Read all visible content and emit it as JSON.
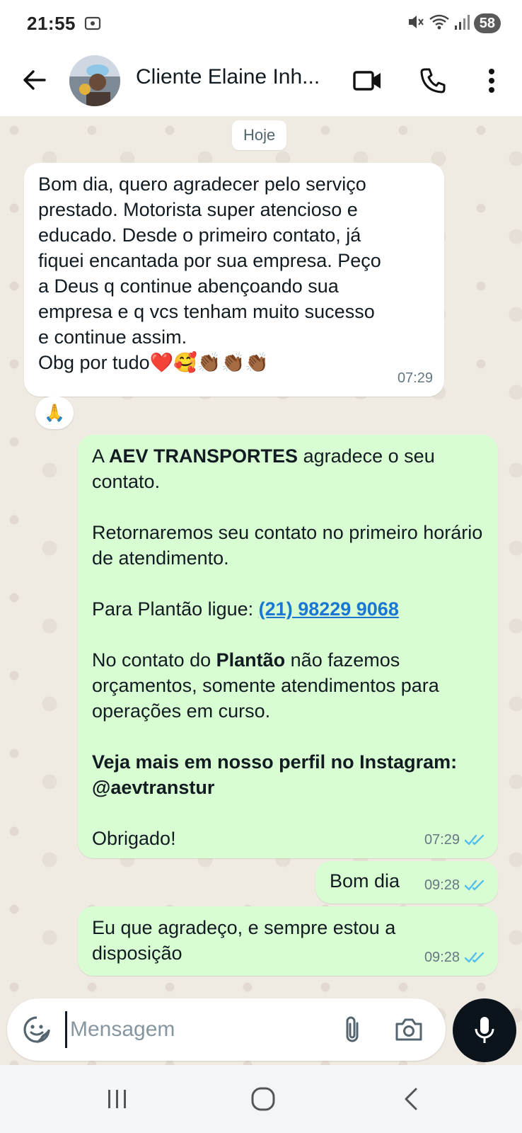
{
  "status_bar": {
    "time": "21:55",
    "battery": "58"
  },
  "header": {
    "contact_name": "Cliente Elaine Inh..."
  },
  "chat": {
    "date_chip": "Hoje",
    "messages": [
      {
        "direction": "incoming",
        "lines": [
          "Bom dia,  quero agradecer pelo serviço",
          "prestado. Motorista super atencioso e",
          "educado. Desde o primeiro contato, já",
          "fiquei encantada por sua empresa. Peço",
          "a Deus q continue abençoando sua",
          "empresa e q vcs tenham muito sucesso",
          "e continue assim.",
          "Obg por tudo❤️🥰👏🏾👏🏾👏🏾"
        ],
        "time": "07:29",
        "reaction": "🙏"
      },
      {
        "direction": "outgoing",
        "p1_prefix": "A ",
        "p1_bold": "AEV TRANSPORTES",
        "p1_suffix": " agradece o seu contato.",
        "p2": "Retornaremos seu contato no primeiro horário de atendimento.",
        "p3_prefix": "Para Plantão ligue: ",
        "p3_link": "(21) 98229 9068",
        "p4_prefix": "No contato do ",
        "p4_bold": "Plantão",
        "p4_suffix": " não fazemos orçamentos, somente atendimentos para operações em curso.",
        "p5_bold": "Veja mais em nosso perfil no Instagram: @aevtranstur",
        "p6": "Obrigado!",
        "time": "07:29"
      },
      {
        "direction": "outgoing",
        "text": "Bom dia",
        "time": "09:28"
      },
      {
        "direction": "outgoing",
        "text": "Eu que agradeço, e sempre estou a disposição",
        "time": "09:28"
      }
    ]
  },
  "input": {
    "placeholder": "Mensagem"
  },
  "colors": {
    "chat_background": "#efeae2",
    "outgoing_bubble": "#d9fdd3",
    "incoming_bubble": "#ffffff",
    "read_ticks": "#53bdeb",
    "link": "#1976d2"
  },
  "icons": {
    "back": "arrow-left-icon",
    "video": "video-camera-icon",
    "call": "phone-icon",
    "menu": "more-vertical-icon",
    "emoji": "sticker-smile-icon",
    "attach": "paperclip-icon",
    "camera": "camera-icon",
    "mic": "microphone-icon"
  }
}
